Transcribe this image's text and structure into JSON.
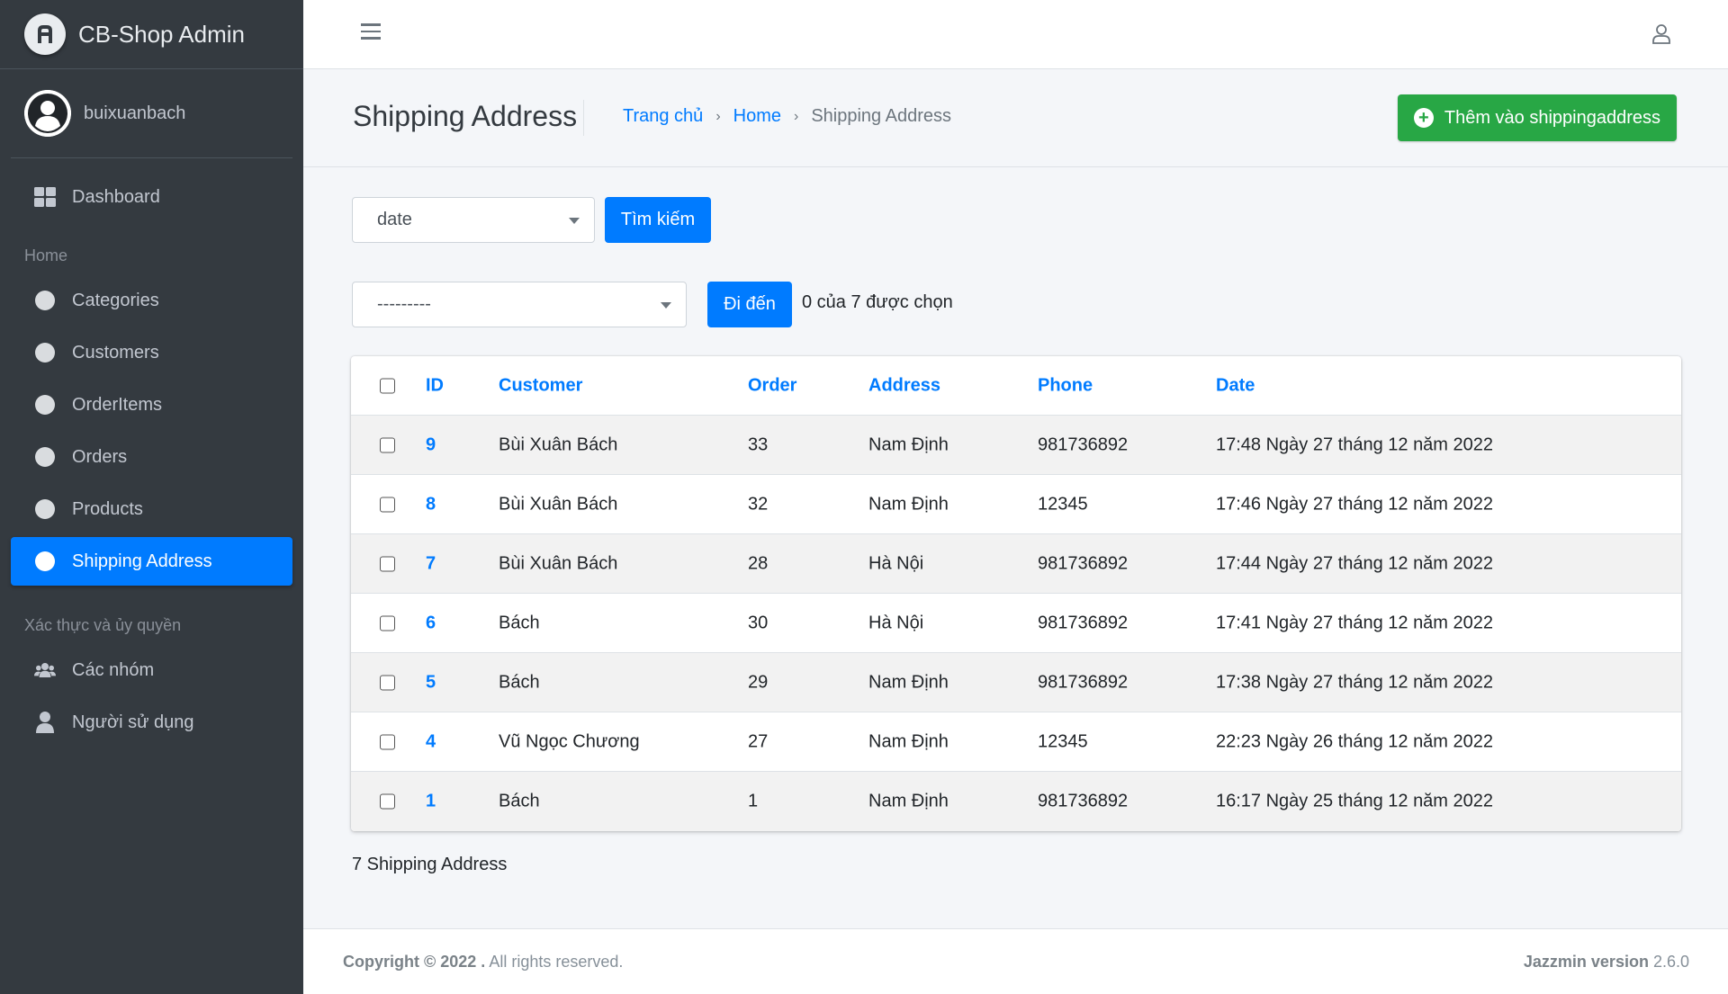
{
  "brand": {
    "name": "CB-Shop Admin"
  },
  "user": {
    "name": "buixuanbach"
  },
  "sidebar": {
    "dashboard": "Dashboard",
    "section_home": "Home",
    "home_items": [
      {
        "label": "Categories"
      },
      {
        "label": "Customers"
      },
      {
        "label": "OrderItems"
      },
      {
        "label": "Orders"
      },
      {
        "label": "Products"
      },
      {
        "label": "Shipping Address"
      }
    ],
    "section_auth": "Xác thực và ủy quyền",
    "auth_items": [
      {
        "label": "Các nhóm",
        "icon": "users-icon"
      },
      {
        "label": "Người sử dụng",
        "icon": "user-icon"
      }
    ],
    "active": "Shipping Address"
  },
  "header": {
    "title": "Shipping Address",
    "breadcrumb": [
      "Trang chủ",
      "Home",
      "Shipping Address"
    ],
    "add_button": "Thêm vào shippingaddress"
  },
  "filters": {
    "date_select": "date",
    "search_button": "Tìm kiếm",
    "action_select": "---------",
    "go_button": "Đi đến",
    "selected_count": "0 của 7 được chọn"
  },
  "table": {
    "columns": [
      "ID",
      "Customer",
      "Order",
      "Address",
      "Phone",
      "Date"
    ],
    "rows": [
      {
        "id": "9",
        "customer": "Bùi Xuân Bách",
        "order": "33",
        "address": "Nam Định",
        "phone": "981736892",
        "date": "17:48 Ngày 27 tháng 12 năm 2022"
      },
      {
        "id": "8",
        "customer": "Bùi Xuân Bách",
        "order": "32",
        "address": "Nam Định",
        "phone": "12345",
        "date": "17:46 Ngày 27 tháng 12 năm 2022"
      },
      {
        "id": "7",
        "customer": "Bùi Xuân Bách",
        "order": "28",
        "address": "Hà Nội",
        "phone": "981736892",
        "date": "17:44 Ngày 27 tháng 12 năm 2022"
      },
      {
        "id": "6",
        "customer": "Bách",
        "order": "30",
        "address": "Hà Nội",
        "phone": "981736892",
        "date": "17:41 Ngày 27 tháng 12 năm 2022"
      },
      {
        "id": "5",
        "customer": "Bách",
        "order": "29",
        "address": "Nam Định",
        "phone": "981736892",
        "date": "17:38 Ngày 27 tháng 12 năm 2022"
      },
      {
        "id": "4",
        "customer": "Vũ Ngọc Chương",
        "order": "27",
        "address": "Nam Định",
        "phone": "12345",
        "date": "22:23 Ngày 26 tháng 12 năm 2022"
      },
      {
        "id": "1",
        "customer": "Bách",
        "order": "1",
        "address": "Nam Định",
        "phone": "981736892",
        "date": "16:17 Ngày 25 tháng 12 năm 2022"
      }
    ]
  },
  "result_count": "7 Shipping Address",
  "footer": {
    "copyright_bold": "Copyright © 2022 .",
    "copyright_rest": " All rights reserved.",
    "version_label": "Jazzmin version",
    "version": " 2.6.0"
  },
  "colors": {
    "sidebar_bg": "#343a40",
    "accent": "#007bff",
    "success": "#28a745"
  }
}
